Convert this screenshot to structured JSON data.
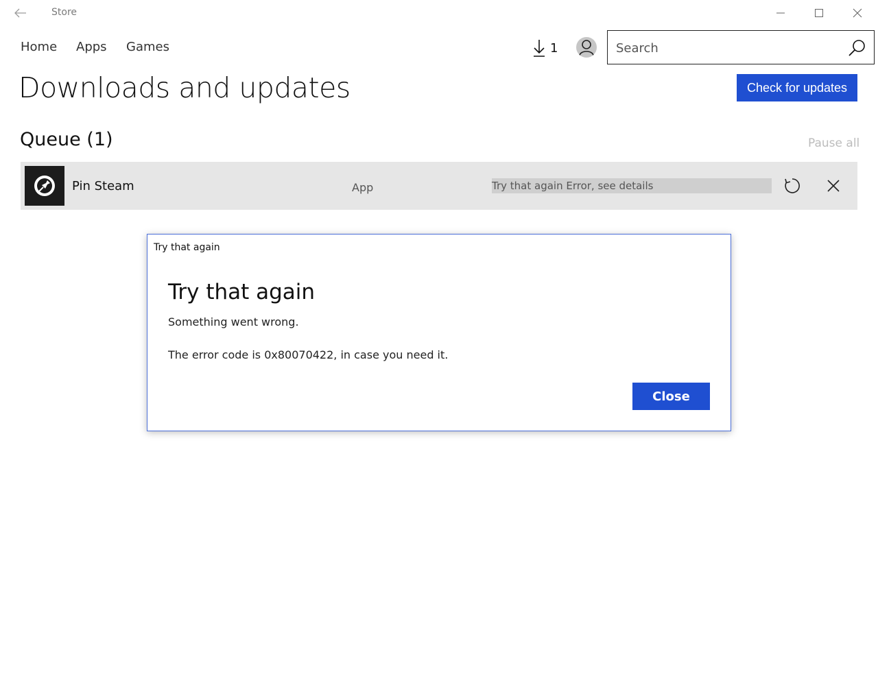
{
  "window": {
    "title": "Store"
  },
  "nav": {
    "items": [
      "Home",
      "Apps",
      "Games"
    ],
    "downloads_count": "1",
    "search_placeholder": "Search"
  },
  "page": {
    "title": "Downloads and updates",
    "check_button": "Check for updates"
  },
  "queue": {
    "title": "Queue (1)",
    "pause_all": "Pause all",
    "items": [
      {
        "name": "Pin Steam",
        "type": "App",
        "status": "Try that again Error, see details"
      }
    ]
  },
  "dialog": {
    "caption": "Try that again",
    "heading": "Try that again",
    "message": "Something went wrong.",
    "error_text": "The error code is 0x80070422, in case you need it.",
    "close_button": "Close"
  },
  "colors": {
    "accent": "#1f4fd1",
    "row_bg": "#e6e6e6",
    "status_bar": "#cfcfcf"
  },
  "icons": [
    "back-arrow-icon",
    "minimize-icon",
    "maximize-icon",
    "close-window-icon",
    "download-icon",
    "user-icon",
    "search-icon",
    "pin-icon",
    "retry-icon",
    "remove-icon"
  ]
}
